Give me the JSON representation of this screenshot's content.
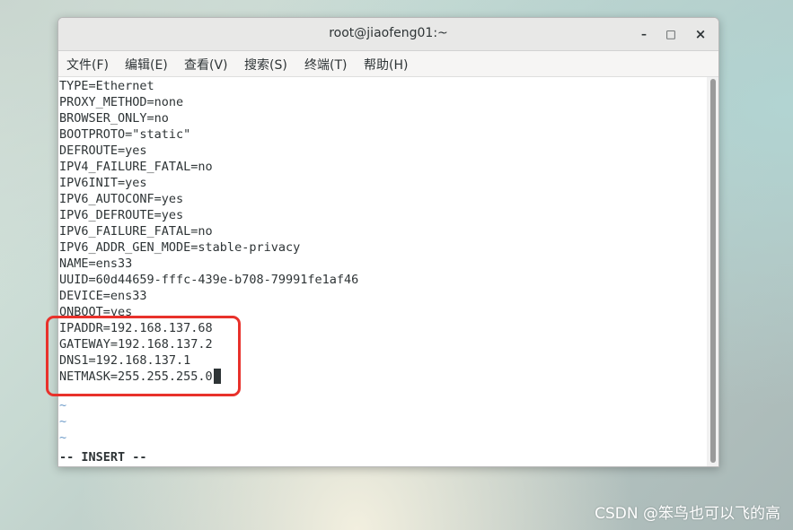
{
  "window": {
    "title": "root@jiaofeng01:~",
    "minimize_label": "–",
    "maximize_label": "□",
    "close_label": "×"
  },
  "menu": [
    "文件(F)",
    "编辑(E)",
    "查看(V)",
    "搜索(S)",
    "终端(T)",
    "帮助(H)"
  ],
  "terminal": {
    "lines": [
      "TYPE=Ethernet",
      "PROXY_METHOD=none",
      "BROWSER_ONLY=no",
      "BOOTPROTO=\"static\"",
      "DEFROUTE=yes",
      "IPV4_FAILURE_FATAL=no",
      "IPV6INIT=yes",
      "IPV6_AUTOCONF=yes",
      "IPV6_DEFROUTE=yes",
      "IPV6_FAILURE_FATAL=no",
      "IPV6_ADDR_GEN_MODE=stable-privacy",
      "NAME=ens33",
      "UUID=60d44659-fffc-439e-b708-79991fe1af46",
      "DEVICE=ens33",
      "ONBOOT=yes",
      "IPADDR=192.168.137.68",
      "GATEWAY=192.168.137.2",
      "DNS1=192.168.137.1",
      "NETMASK=255.255.255.0"
    ],
    "tildes": [
      "~",
      "~",
      "~"
    ],
    "status": "-- INSERT --"
  },
  "watermark": "CSDN @笨鸟也可以飞的高"
}
